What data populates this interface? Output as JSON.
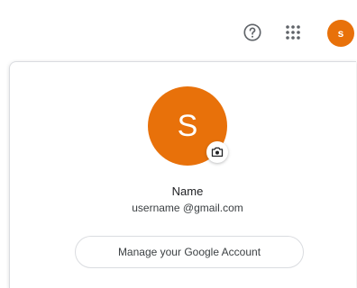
{
  "header": {
    "help_icon": "help-circle-icon",
    "apps_icon": "apps-grid-icon",
    "avatar_initial": "s"
  },
  "account_card": {
    "avatar_initial": "S",
    "camera_icon": "camera-icon",
    "name": "Name",
    "email": "username @gmail.com",
    "manage_button_label": "Manage your Google Account"
  },
  "colors": {
    "avatar_bg": "#e8710a",
    "text_primary": "#202124",
    "text_secondary": "#3c4043",
    "border": "#dadce0"
  }
}
